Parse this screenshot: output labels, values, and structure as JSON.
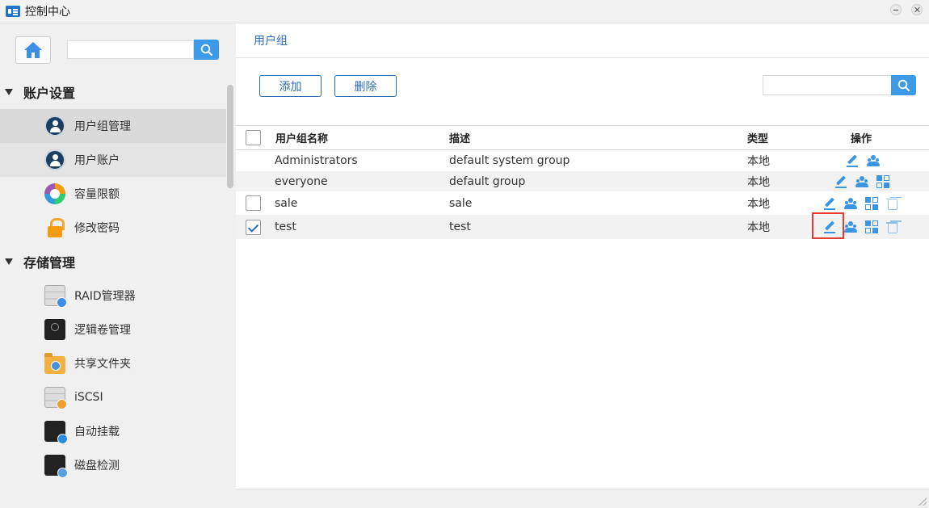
{
  "window": {
    "title": "控制中心"
  },
  "sidebar": {
    "sections": [
      {
        "label": "账户设置",
        "items": [
          {
            "label": "用户组管理",
            "icon": "user-group-icon",
            "state": "active"
          },
          {
            "label": "用户账户",
            "icon": "user-account-icon",
            "state": "hover"
          },
          {
            "label": "容量限额",
            "icon": "quota-icon",
            "state": ""
          },
          {
            "label": "修改密码",
            "icon": "lock-icon",
            "state": ""
          }
        ]
      },
      {
        "label": "存储管理",
        "items": [
          {
            "label": "RAID管理器",
            "icon": "raid-icon",
            "state": ""
          },
          {
            "label": "逻辑卷管理",
            "icon": "lvm-icon",
            "state": ""
          },
          {
            "label": "共享文件夹",
            "icon": "shared-folder-icon",
            "state": ""
          },
          {
            "label": "iSCSI",
            "icon": "iscsi-icon",
            "state": ""
          },
          {
            "label": "自动挂载",
            "icon": "auto-mount-icon",
            "state": ""
          },
          {
            "label": "磁盘检测",
            "icon": "disk-check-icon",
            "state": ""
          }
        ]
      }
    ],
    "search": {
      "placeholder": "",
      "value": ""
    }
  },
  "main": {
    "breadcrumb": "用户组",
    "toolbar": {
      "add_label": "添加",
      "delete_label": "删除",
      "search_placeholder": ""
    },
    "table": {
      "columns": [
        "用户组名称",
        "描述",
        "类型",
        "操作"
      ],
      "rows": [
        {
          "name": "Administrators",
          "description": "default system group",
          "type": "本地",
          "has_checkbox": false,
          "checked": false,
          "ops": [
            "edit",
            "members"
          ]
        },
        {
          "name": "everyone",
          "description": "default group",
          "type": "本地",
          "has_checkbox": false,
          "checked": false,
          "ops": [
            "edit",
            "members",
            "permissions"
          ]
        },
        {
          "name": "sale",
          "description": "sale",
          "type": "本地",
          "has_checkbox": true,
          "checked": false,
          "ops": [
            "edit",
            "members",
            "permissions",
            "delete"
          ]
        },
        {
          "name": "test",
          "description": "test",
          "type": "本地",
          "has_checkbox": true,
          "checked": true,
          "ops": [
            "edit",
            "members",
            "permissions",
            "delete"
          ]
        }
      ]
    }
  },
  "colors": {
    "accent": "#2f6db3",
    "search_button": "#3d9ae8",
    "highlight": "#e53935"
  }
}
